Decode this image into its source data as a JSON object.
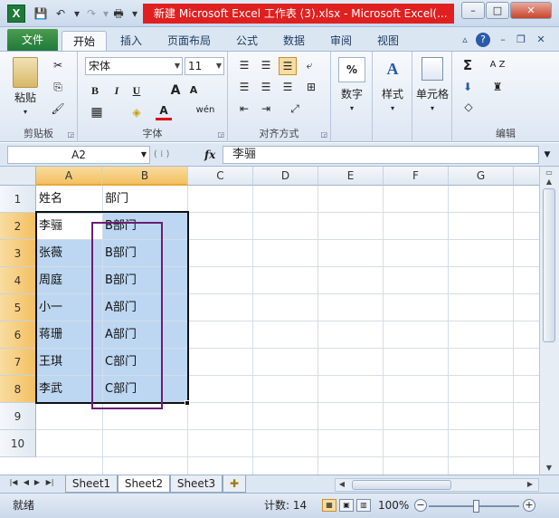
{
  "window": {
    "title": "新建 Microsoft Excel 工作表 (3).xlsx  -  Microsoft Excel(...",
    "logo_letter": "X",
    "minimize": "–",
    "maximize": "□",
    "close": "✕"
  },
  "qat": {
    "save_icon": "💾",
    "undo_icon": "↶",
    "redo_icon": "↷",
    "print_icon": "🖶",
    "more_icon": "▾"
  },
  "ribbon_tabs": [
    "文件",
    "开始",
    "插入",
    "页面布局",
    "公式",
    "数据",
    "审阅",
    "视图"
  ],
  "ribbon_tab_icons": {
    "minimize_ribbon": "▵",
    "help": "?",
    "restore": "❐",
    "close": "✕"
  },
  "ribbon": {
    "clipboard": {
      "paste": "粘贴",
      "label": "剪贴板",
      "cut_icon": "✂",
      "copy_icon": "⎘",
      "format_painter_icon": "🖌"
    },
    "font": {
      "font_name": "宋体",
      "font_size": "11",
      "label": "字体",
      "bold": "B",
      "italic": "I",
      "underline": "U",
      "grow": "A",
      "shrink": "A",
      "border_icon": "▦",
      "fill_icon": "◈",
      "color_icon": "A",
      "phonetic": "wén"
    },
    "alignment": {
      "label": "对齐方式"
    },
    "number": {
      "label": "数字",
      "icon": "%"
    },
    "styles": {
      "label": "样式",
      "icon": "A"
    },
    "cells": {
      "label": "单元格"
    },
    "editing": {
      "label": "编辑",
      "sum": "Σ",
      "sort": "A Z",
      "find": "♜"
    }
  },
  "formula_bar": {
    "name_box": "A2",
    "fx": "fx",
    "content": "李骊"
  },
  "columns": [
    "A",
    "B",
    "C",
    "D",
    "E",
    "F",
    "G"
  ],
  "rows": [
    "1",
    "2",
    "3",
    "4",
    "5",
    "6",
    "7",
    "8",
    "9",
    "10"
  ],
  "cells": {
    "A": [
      "姓名",
      "李骊",
      "张薇",
      "周庭",
      "小一",
      "蒋珊",
      "王琪",
      "李武"
    ],
    "B": [
      "部门",
      "B部门",
      "B部门",
      "B部门",
      "A部门",
      "A部门",
      "C部门",
      "C部门"
    ]
  },
  "sheets": [
    "Sheet1",
    "Sheet2",
    "Sheet3"
  ],
  "active_sheet": "Sheet2",
  "status": {
    "ready": "就绪",
    "count": "计数: 14",
    "zoom": "100%",
    "zoom_minus": "−",
    "zoom_plus": "+"
  }
}
